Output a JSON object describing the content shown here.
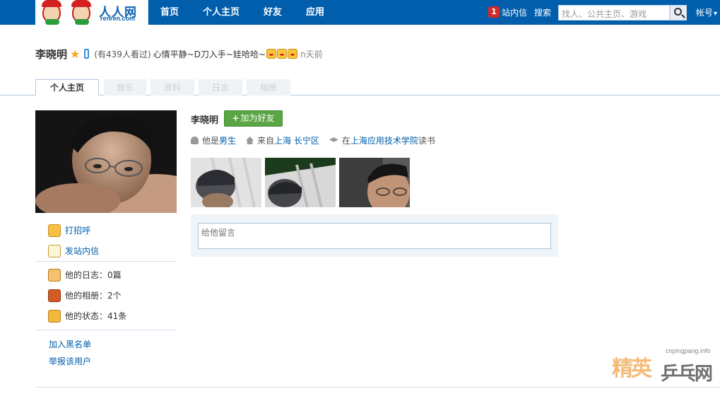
{
  "header": {
    "logo_text": "人人网",
    "logo_domain": "renren.com",
    "nav": [
      "首页",
      "个人主页",
      "好友",
      "应用"
    ],
    "message_count": "1",
    "messages_label": "站内信",
    "search_label": "搜索",
    "search_placeholder": "找人、公共主页、游戏",
    "account_label": "帐号"
  },
  "profile": {
    "name": "李晓明",
    "visits": "(有439人看过)",
    "status": "心情平静~D刀入手~娃哈哈~",
    "time_ago": "n天前"
  },
  "tabs": [
    "个人主页",
    "音乐",
    "资料",
    "日志",
    "相册"
  ],
  "sidebar": {
    "actions": [
      "打招呼",
      "发站内信"
    ],
    "stats": [
      "他的日志：0篇",
      "他的相册：2个",
      "他的状态：41条"
    ],
    "links": [
      "加入黑名单",
      "举报该用户"
    ]
  },
  "main": {
    "name": "李晓明",
    "add_friend_label": "加为好友",
    "gender_prefix": "他是",
    "gender": "男生",
    "from_prefix": "来自",
    "from_city": "上海",
    "from_district": "长宁区",
    "school_prefix": "在",
    "school": "上海应用技术学院",
    "school_suffix": "读书",
    "comment_placeholder": "给他留言"
  },
  "watermark": {
    "url": "cnpingpang.info",
    "text_a": "精英",
    "text_b": "乒乓网"
  }
}
